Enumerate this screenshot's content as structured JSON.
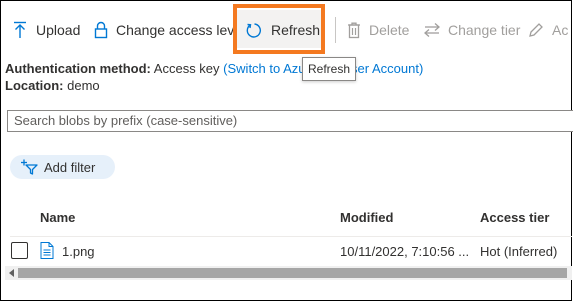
{
  "toolbar": {
    "upload_label": "Upload",
    "change_access_label": "Change access level",
    "refresh_label": "Refresh",
    "delete_label": "Delete",
    "change_tier_label": "Change tier",
    "acquire_label": "Ac"
  },
  "tooltip": {
    "text": "Refresh"
  },
  "info": {
    "auth_key": "Authentication method:",
    "auth_value": "Access key",
    "auth_link": "(Switch to Azure AD User Account)",
    "location_key": "Location:",
    "location_value": "demo"
  },
  "search": {
    "placeholder": "Search blobs by prefix (case-sensitive)"
  },
  "filter": {
    "add_label": "Add filter"
  },
  "table": {
    "headers": {
      "name": "Name",
      "modified": "Modified",
      "access_tier": "Access tier"
    },
    "rows": [
      {
        "name": "1.png",
        "modified": "10/11/2022, 7:10:56 ...",
        "access_tier": "Hot (Inferred)"
      }
    ]
  },
  "colors": {
    "highlight": "#f47920",
    "accent": "#0078d4",
    "disabled": "#a19f9d"
  }
}
